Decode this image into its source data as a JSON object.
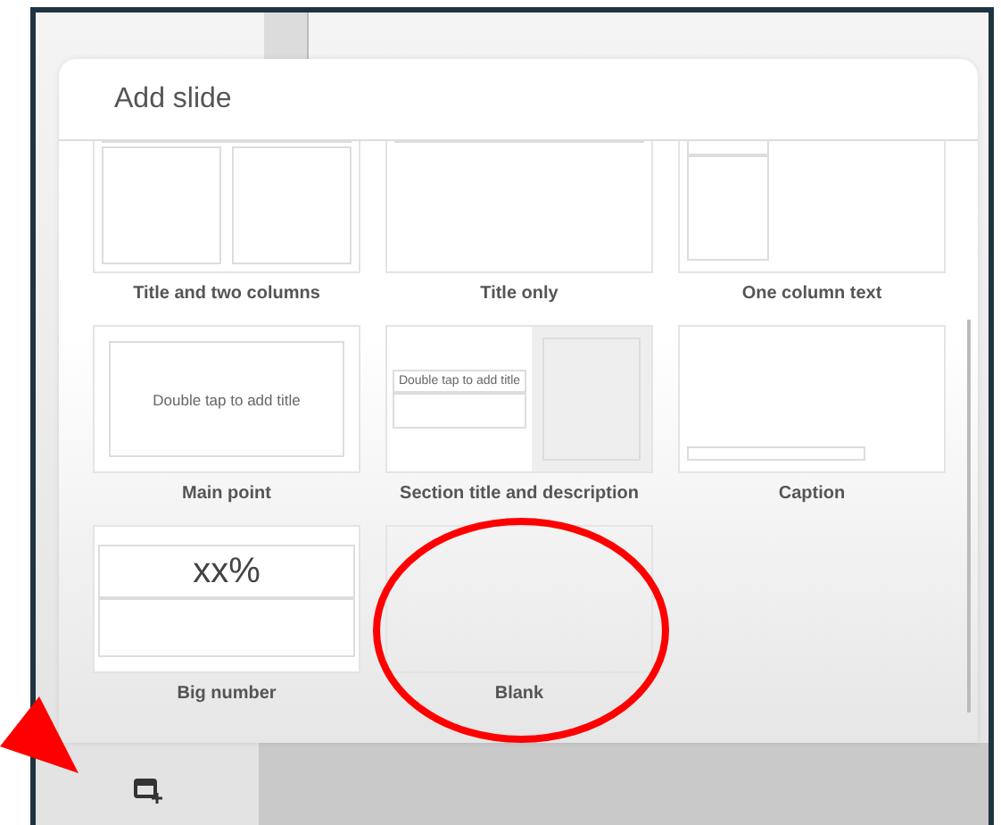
{
  "dialog": {
    "title": "Add slide"
  },
  "layouts": [
    {
      "kind": "two_columns",
      "label": "Title and two columns"
    },
    {
      "kind": "title_only",
      "label": "Title only"
    },
    {
      "kind": "one_column",
      "label": "One column text"
    },
    {
      "kind": "main_point",
      "label": "Main point",
      "thumb_text": "Double tap to add title"
    },
    {
      "kind": "section",
      "label": "Section title and description",
      "thumb_text": "Double tap to add title"
    },
    {
      "kind": "caption",
      "label": "Caption"
    },
    {
      "kind": "big_number",
      "label": "Big number",
      "thumb_text": "xx%"
    },
    {
      "kind": "blank",
      "label": "Blank"
    }
  ],
  "annotations": [
    {
      "kind": "ellipse"
    },
    {
      "kind": "arrow"
    }
  ]
}
